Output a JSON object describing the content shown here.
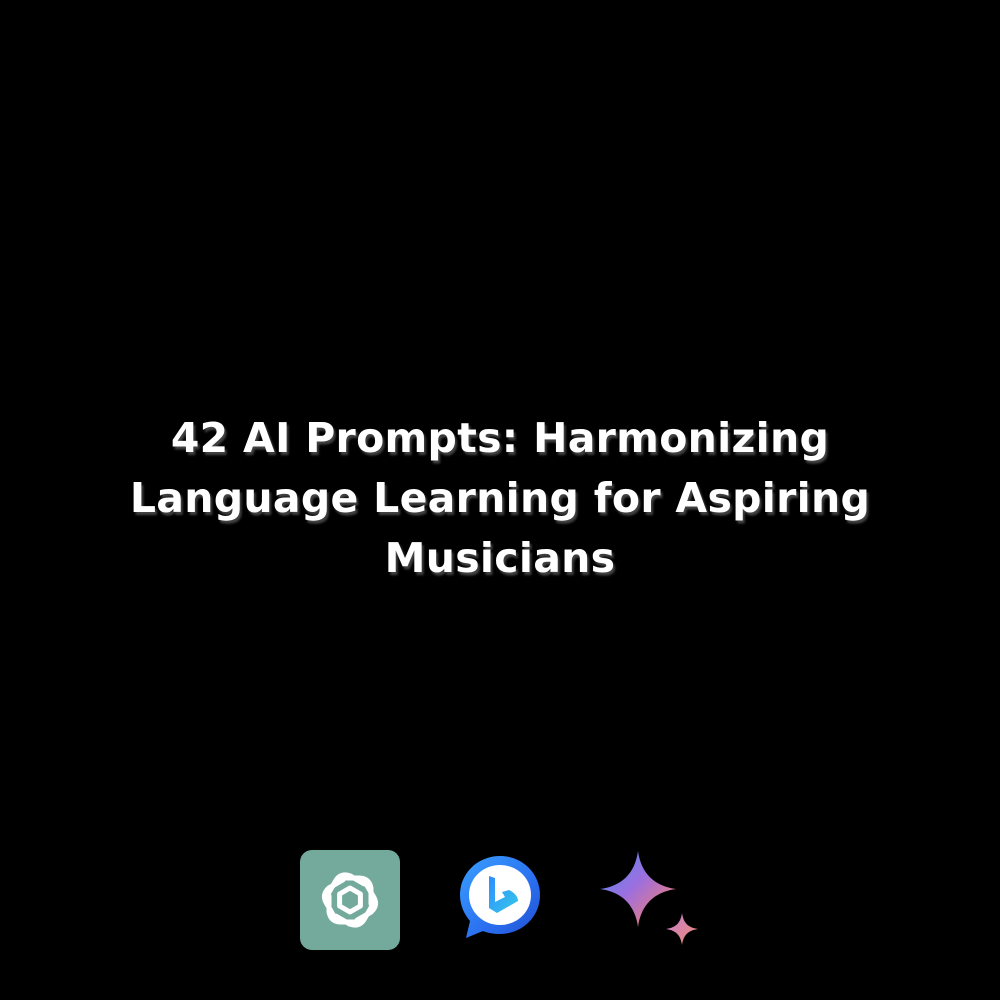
{
  "title": {
    "lines": [
      "42 AI Prompts: Harmonizing",
      "Language Learning for Aspiring",
      "Musicians"
    ]
  },
  "logos": [
    {
      "icon": "chatgpt-logo-icon",
      "color": "#74aa9c"
    },
    {
      "icon": "bing-chat-logo-icon",
      "color": "#2870ea"
    },
    {
      "icon": "gemini-sparkle-logo-icon",
      "color": "#8e75d9"
    }
  ],
  "colors": {
    "background": "#000000",
    "text": "#ffffff"
  }
}
